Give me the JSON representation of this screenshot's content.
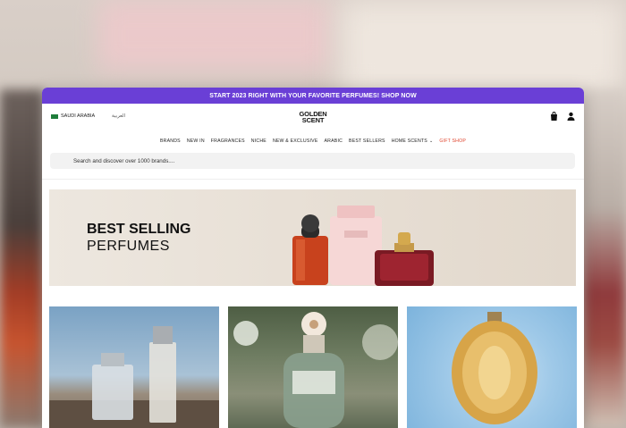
{
  "promo": {
    "text": "START 2023 RIGHT WITH YOUR FAVORITE PERFUMES! SHOP NOW"
  },
  "header": {
    "country": "SAUDI ARABIA",
    "language": "العربية",
    "logo_line1": "GOLDEN",
    "logo_line2": "SCENT"
  },
  "nav": {
    "items": [
      "BRANDS",
      "NEW IN",
      "FRAGRANCES",
      "NICHE",
      "NEW & EXCLUSIVE",
      "ARABIC",
      "BEST SELLERS",
      "HOME SCENTS",
      "GIFT SHOP"
    ]
  },
  "search": {
    "placeholder": "Search and discover over 1000 brands...."
  },
  "hero": {
    "title_line1": "BEST SELLING",
    "title_line2": "PERFUMES"
  },
  "colors": {
    "promo_bg": "#6a3fd6",
    "gift_shop": "#e0452e"
  },
  "icons": [
    "flag-icon",
    "bag-icon",
    "user-icon",
    "chevron-down-icon"
  ]
}
